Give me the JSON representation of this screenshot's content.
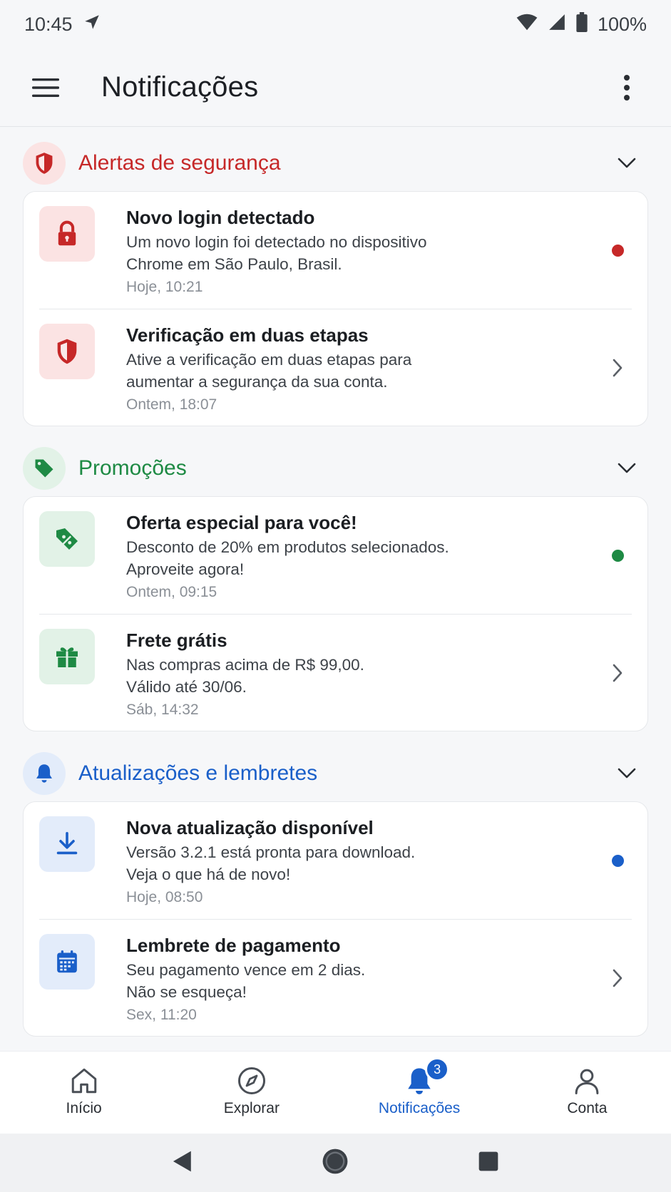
{
  "status_bar": {
    "time": "10:45",
    "battery": "100%"
  },
  "app_bar": {
    "title": "Notificações"
  },
  "colors": {
    "red": "#c62828",
    "green": "#1e8a44",
    "blue": "#1a5fc9"
  },
  "sections": [
    {
      "title": "Alertas de segurança",
      "icon": "shield-icon",
      "items": [
        {
          "title": "Novo login detectado",
          "desc": "Um novo login foi detectado no dispositivo\nChrome em São Paulo, Brasil.",
          "time": "Hoje, 10:21",
          "icon": "lock-icon",
          "unread": true
        },
        {
          "title": "Verificação em duas etapas",
          "desc": "Ative a verificação em duas etapas para\naumentar a segurança da sua conta.",
          "time": "Ontem, 18:07",
          "icon": "shield-icon",
          "unread": false
        }
      ]
    },
    {
      "title": "Promoções",
      "icon": "tag-icon",
      "items": [
        {
          "title": "Oferta especial para você!",
          "desc": "Desconto de 20% em produtos selecionados.\nAproveite agora!",
          "time": "Ontem, 09:15",
          "icon": "discount-tag-icon",
          "unread": true
        },
        {
          "title": "Frete grátis",
          "desc": "Nas compras acima de R$ 99,00.\nVálido até 30/06.",
          "time": "Sáb, 14:32",
          "icon": "gift-icon",
          "unread": false
        }
      ]
    },
    {
      "title": "Atualizações e lembretes",
      "icon": "bell-icon",
      "items": [
        {
          "title": "Nova atualização disponível",
          "desc": "Versão 3.2.1 está pronta para download.\nVeja o que há de novo!",
          "time": "Hoje, 08:50",
          "icon": "download-icon",
          "unread": true
        },
        {
          "title": "Lembrete de pagamento",
          "desc": "Seu pagamento vence em 2 dias.\nNão se esqueça!",
          "time": "Sex, 11:20",
          "icon": "calendar-icon",
          "unread": false
        }
      ]
    }
  ],
  "bottom_nav": {
    "items": [
      {
        "label": "Início",
        "icon": "home-icon"
      },
      {
        "label": "Explorar",
        "icon": "compass-icon"
      },
      {
        "label": "Notificações",
        "icon": "bell-icon",
        "active": true,
        "badge": "3"
      },
      {
        "label": "Conta",
        "icon": "person-icon"
      }
    ]
  }
}
